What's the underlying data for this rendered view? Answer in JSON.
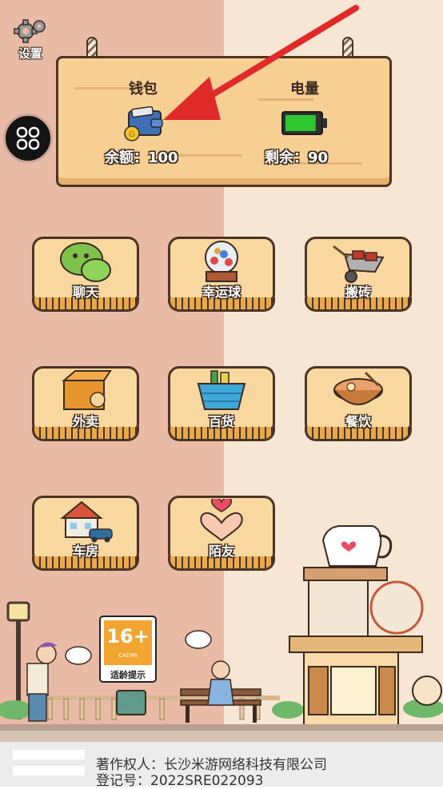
{
  "settings": {
    "label": "设置"
  },
  "wallet": {
    "title": "钱包",
    "balance": "余额：100",
    "icon": "wallet-icon"
  },
  "battery": {
    "title": "电量",
    "remaining": "剩余：90",
    "level": 0.9,
    "icon": "battery-icon"
  },
  "apps": [
    {
      "label": "聊天",
      "icon": "chat-icon"
    },
    {
      "label": "幸运球",
      "icon": "lucky-ball-icon"
    },
    {
      "label": "搬砖",
      "icon": "wheelbarrow-icon"
    },
    {
      "label": "外卖",
      "icon": "delivery-box-icon"
    },
    {
      "label": "百货",
      "icon": "shopping-basket-icon"
    },
    {
      "label": "餐饮",
      "icon": "food-bowl-icon"
    },
    {
      "label": "车房",
      "icon": "house-car-icon"
    },
    {
      "label": "陌友",
      "icon": "heart-hands-icon"
    }
  ],
  "age_rating": {
    "value": "16+",
    "org": "CADPA",
    "tip": "适龄提示"
  },
  "footer": {
    "copyright": "著作权人：长沙米游网络科技有限公司",
    "registration": "登记号：2022SRE022093"
  },
  "colors": {
    "accent_red": "#e02a2a",
    "battery_green": "#2ec62e",
    "tile_face": "#f8d89e"
  }
}
